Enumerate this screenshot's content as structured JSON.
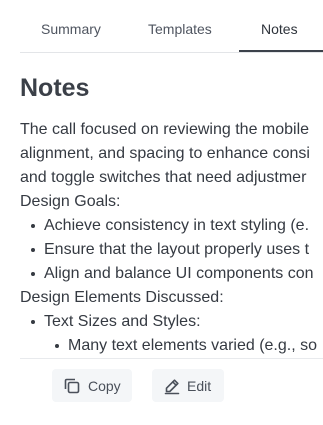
{
  "tabs": [
    {
      "label": "Summary"
    },
    {
      "label": "Templates"
    },
    {
      "label": "Notes"
    }
  ],
  "active_tab": "Notes",
  "notes": {
    "title": "Notes",
    "lines": [
      "The call focused on reviewing the mobile",
      "alignment, and spacing to enhance consi",
      "and toggle switches that need adjustmer",
      "Design Goals:"
    ],
    "design_goals": [
      "Achieve consistency in text styling (e.",
      "Ensure that the layout properly uses t",
      "Align and balance UI components con"
    ],
    "section_heading": "Design Elements Discussed:",
    "elements": [
      "Text Sizes and Styles:"
    ],
    "sub_items": [
      "Many text elements varied (e.g., so"
    ]
  },
  "actions": {
    "copy_label": "Copy",
    "edit_label": "Edit"
  },
  "icons": {
    "copy": "copy-icon",
    "edit": "pencil-icon"
  }
}
